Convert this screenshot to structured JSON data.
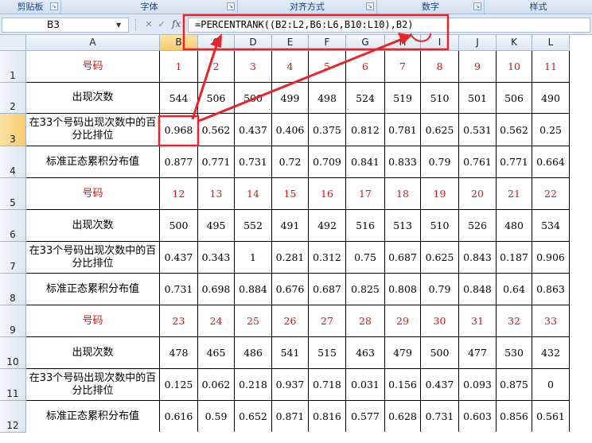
{
  "ribbon": {
    "groups": [
      {
        "label": "剪贴板"
      },
      {
        "label": "字体"
      },
      {
        "label": "对齐方式"
      },
      {
        "label": "数字"
      },
      {
        "label": "样式"
      }
    ]
  },
  "formula_bar": {
    "name_box": "B3",
    "fx": "fx",
    "formula": "=PERCENTRANK((B2:L2,B6:L6,B10:L10),B2)"
  },
  "sheet": {
    "selected_cell": "B3",
    "columns": [
      "A",
      "B",
      "C",
      "D",
      "E",
      "F",
      "G",
      "H",
      "I",
      "J",
      "K",
      "L"
    ],
    "rows": [
      "1",
      "2",
      "3",
      "4",
      "5",
      "6",
      "7",
      "8",
      "9",
      "10",
      "11",
      "12"
    ],
    "labels": {
      "number": "号码",
      "count": "出现次数",
      "rank": "在33个号码出现次数中的百分比排位",
      "normdist": "标准正态累积分布值"
    },
    "blocks": [
      {
        "numbers": [
          "1",
          "2",
          "3",
          "4",
          "5",
          "6",
          "7",
          "8",
          "9",
          "10",
          "11"
        ],
        "counts": [
          "544",
          "506",
          "500",
          "499",
          "498",
          "524",
          "519",
          "510",
          "501",
          "506",
          "490"
        ],
        "ranks": [
          "0.968",
          "0.562",
          "0.437",
          "0.406",
          "0.375",
          "0.812",
          "0.781",
          "0.625",
          "0.531",
          "0.562",
          "0.25"
        ],
        "norms": [
          "0.877",
          "0.771",
          "0.731",
          "0.72",
          "0.709",
          "0.841",
          "0.833",
          "0.79",
          "0.761",
          "0.771",
          "0.664"
        ]
      },
      {
        "numbers": [
          "12",
          "13",
          "14",
          "15",
          "16",
          "17",
          "18",
          "19",
          "20",
          "21",
          "22"
        ],
        "counts": [
          "500",
          "495",
          "552",
          "491",
          "492",
          "516",
          "513",
          "510",
          "526",
          "480",
          "534"
        ],
        "ranks": [
          "0.437",
          "0.343",
          "1",
          "0.281",
          "0.312",
          "0.75",
          "0.687",
          "0.625",
          "0.843",
          "0.187",
          "0.906"
        ],
        "norms": [
          "0.731",
          "0.698",
          "0.884",
          "0.676",
          "0.687",
          "0.825",
          "0.808",
          "0.79",
          "0.848",
          "0.64",
          "0.863"
        ]
      },
      {
        "numbers": [
          "23",
          "24",
          "25",
          "26",
          "27",
          "28",
          "29",
          "30",
          "31",
          "32",
          "33"
        ],
        "counts": [
          "478",
          "465",
          "486",
          "541",
          "515",
          "463",
          "479",
          "500",
          "477",
          "530",
          "432"
        ],
        "ranks": [
          "0.125",
          "0.062",
          "0.218",
          "0.937",
          "0.718",
          "0.031",
          "0.156",
          "0.437",
          "0.093",
          "0.875",
          "0"
        ],
        "norms": [
          "0.616",
          "0.59",
          "0.652",
          "0.871",
          "0.816",
          "0.577",
          "0.628",
          "0.731",
          "0.603",
          "0.856",
          "0.561"
        ]
      }
    ]
  },
  "colors": {
    "number_text": "#d11a1a",
    "highlight": "#e8232a",
    "header_selected": "#f8cb6b"
  }
}
